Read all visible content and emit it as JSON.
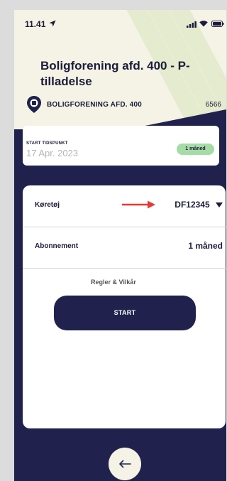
{
  "status_bar": {
    "time": "11.41"
  },
  "header": {
    "title": "Boligforening afd. 400 - P-tilladelse",
    "zone_name": "BOLIGFORENING AFD. 400",
    "zone_code": "6566"
  },
  "start": {
    "label": "START TIDSPUNKT",
    "date": "17 Apr. 2023",
    "badge": "1 måned"
  },
  "form": {
    "vehicle_label": "Køretøj",
    "vehicle_value": "DF12345",
    "subscription_label": "Abonnement",
    "subscription_value": "1 måned"
  },
  "actions": {
    "terms": "Regler & Vilkår",
    "start_button": "START"
  },
  "icons": {
    "location": "location-arrow-icon",
    "pin": "parking-pin-icon",
    "dropdown": "caret-down-icon",
    "back": "arrow-left-icon"
  },
  "colors": {
    "navy": "#20224d",
    "cream": "#f5f3e6",
    "badge_green": "#a5dca6",
    "annotation_red": "#e53935"
  }
}
